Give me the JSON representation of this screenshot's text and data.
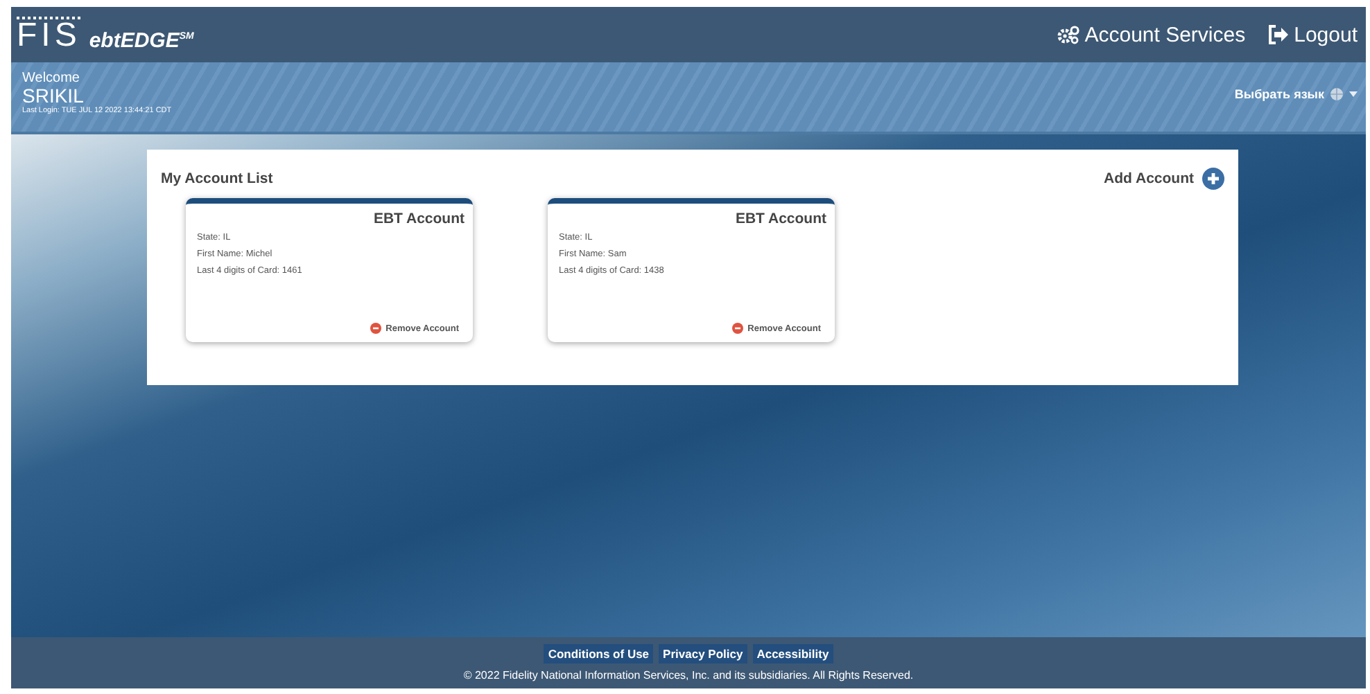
{
  "header": {
    "logo": "FIS",
    "brand": "ebtEDGE$^{SM}$",
    "links": [
      {
        "kind": "services",
        "label": "Account Services"
      },
      {
        "kind": "logout",
        "label": "Logout"
      }
    ]
  },
  "welcome": {
    "greeting": "Welcome",
    "user": "SRIKIL",
    "last_login": "Last Login: TUE JUL 12 2022 13:44:21 CDT",
    "language": "Выбрать язык"
  },
  "account_list": {
    "title": "My Account List",
    "add_label": "Add Account",
    "cards": [
      {
        "title": "EBT Account",
        "lines": [
          "State: IL",
          "First Name: Michel",
          "Last 4 digits of Card: 1461"
        ],
        "remove_label": "Remove Account"
      },
      {
        "title": "EBT Account",
        "lines": [
          "State: IL",
          "First Name: Sam",
          "Last 4 digits of Card: 1438"
        ],
        "remove_label": "Remove Account"
      }
    ]
  },
  "footer": {
    "links": [
      "Conditions of Use",
      "Privacy Policy",
      "Accessibility"
    ],
    "copyright": "© 2022 Fidelity National Information Services, Inc. and its subsidiaries. All Rights Reserved."
  }
}
